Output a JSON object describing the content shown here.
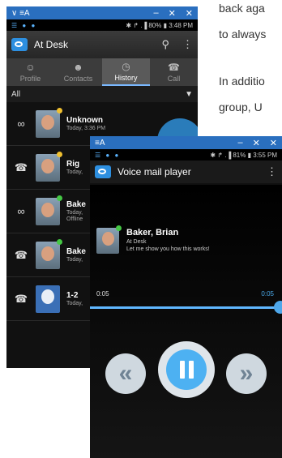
{
  "doc_text": {
    "line1": "back aga",
    "line2": "to always",
    "line3": "In additio",
    "line4": "group, U"
  },
  "back_window": {
    "title": "∨ ≡A",
    "controls": [
      "–",
      "✕",
      "✕"
    ],
    "status": {
      "left": "☰ ● ●",
      "right": "✱ ↱ .▐ 80% ▮ 3:48 PM"
    },
    "app_title": "At Desk",
    "icons": {
      "search": "⚲",
      "menu": "⋮"
    },
    "tabs": [
      {
        "label": "Profile",
        "icon": "☺",
        "active": false
      },
      {
        "label": "Contacts",
        "icon": "☻",
        "active": false
      },
      {
        "label": "History",
        "icon": "◷",
        "active": true
      },
      {
        "label": "Call",
        "icon": "☎",
        "active": false
      }
    ],
    "filter_label": "All",
    "filter_icon": "▼",
    "rows": [
      {
        "name": "Unknown",
        "sub": "Today, 3:36 PM",
        "sub2": "",
        "icon": "∞",
        "dot": "#f0c030",
        "avatar": "photo"
      },
      {
        "name": "Rig",
        "sub": "Today,",
        "sub2": "",
        "icon": "☎",
        "dot": "#f0c030",
        "avatar": "photo"
      },
      {
        "name": "Bake",
        "sub": "Today,",
        "sub2": "Offline",
        "icon": "∞",
        "dot": "#45c845",
        "avatar": "photo"
      },
      {
        "name": "Bake",
        "sub": "Today,",
        "sub2": "",
        "icon": "☎",
        "dot": "#45c845",
        "avatar": "photo"
      },
      {
        "name": "1-2",
        "sub": "Today,",
        "sub2": "",
        "icon": "☎",
        "dot": "",
        "avatar": "blank"
      }
    ]
  },
  "front_window": {
    "title": "≡A",
    "controls": [
      "–",
      "✕",
      "✕"
    ],
    "status": {
      "left": "☰ ● ●",
      "right": "✱ ↱ .▐ 81% ▮ 3:55 PM"
    },
    "app_title": "Voice mail player",
    "menu_icon": "⋮",
    "contact": {
      "name": "Baker, Brian",
      "status": "At Desk",
      "message": "Let me show you how this works!",
      "dot": "#45c845"
    },
    "time_elapsed": "0:05",
    "time_total": "0:05",
    "progress": 1.0,
    "buttons": {
      "rewind": "«",
      "pause": "pause",
      "forward": "»"
    }
  },
  "colors": {
    "accent": "#2f8fd8",
    "title_bar": "#2a6fbf"
  }
}
